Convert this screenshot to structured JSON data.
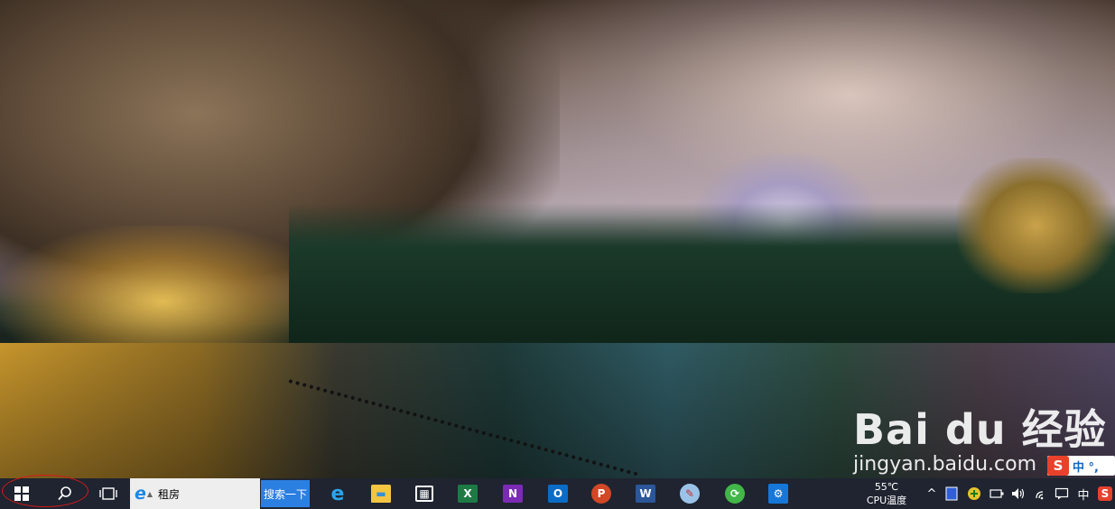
{
  "wallpaper": {
    "watermark_brand": "Bai du 经验",
    "watermark_site": "jingyan.baidu.com"
  },
  "taskbar": {
    "start_icon": "windows-logo-icon",
    "search_icon": "search-icon",
    "taskview_icon": "task-view-icon",
    "search_box": {
      "browser_icon": "ie-icon",
      "browser_glyph": "e",
      "dropdown_glyph": "▲",
      "text": "租房",
      "button_label": "搜索一下"
    },
    "pinned_apps": [
      {
        "name": "edge-icon",
        "glyph": "e"
      },
      {
        "name": "file-explorer-icon",
        "glyph": "▬"
      },
      {
        "name": "store-icon",
        "glyph": "▦"
      },
      {
        "name": "excel-icon",
        "glyph": "X"
      },
      {
        "name": "onenote-icon",
        "glyph": "N"
      },
      {
        "name": "outlook-icon",
        "glyph": "O"
      },
      {
        "name": "powerpoint-icon",
        "glyph": "P"
      },
      {
        "name": "word-icon",
        "glyph": "W"
      },
      {
        "name": "paint-icon",
        "glyph": "✎"
      },
      {
        "name": "refresh-app-icon",
        "glyph": "⟳"
      },
      {
        "name": "settings-icon",
        "glyph": "⚙"
      }
    ],
    "temperature": {
      "value": "55℃",
      "label": "CPU温度"
    },
    "tray": {
      "chevron_glyph": "^",
      "network_glyph": "◠",
      "message_glyph": "▭",
      "ime_label": "中",
      "sogou_glyph": "S"
    }
  },
  "sogou_ime": {
    "logo": "S",
    "text": "中 °,"
  },
  "colors": {
    "taskbar": "#1f2430",
    "search_button": "#2b7fe0",
    "annotation_circle": "#d41a1a"
  }
}
